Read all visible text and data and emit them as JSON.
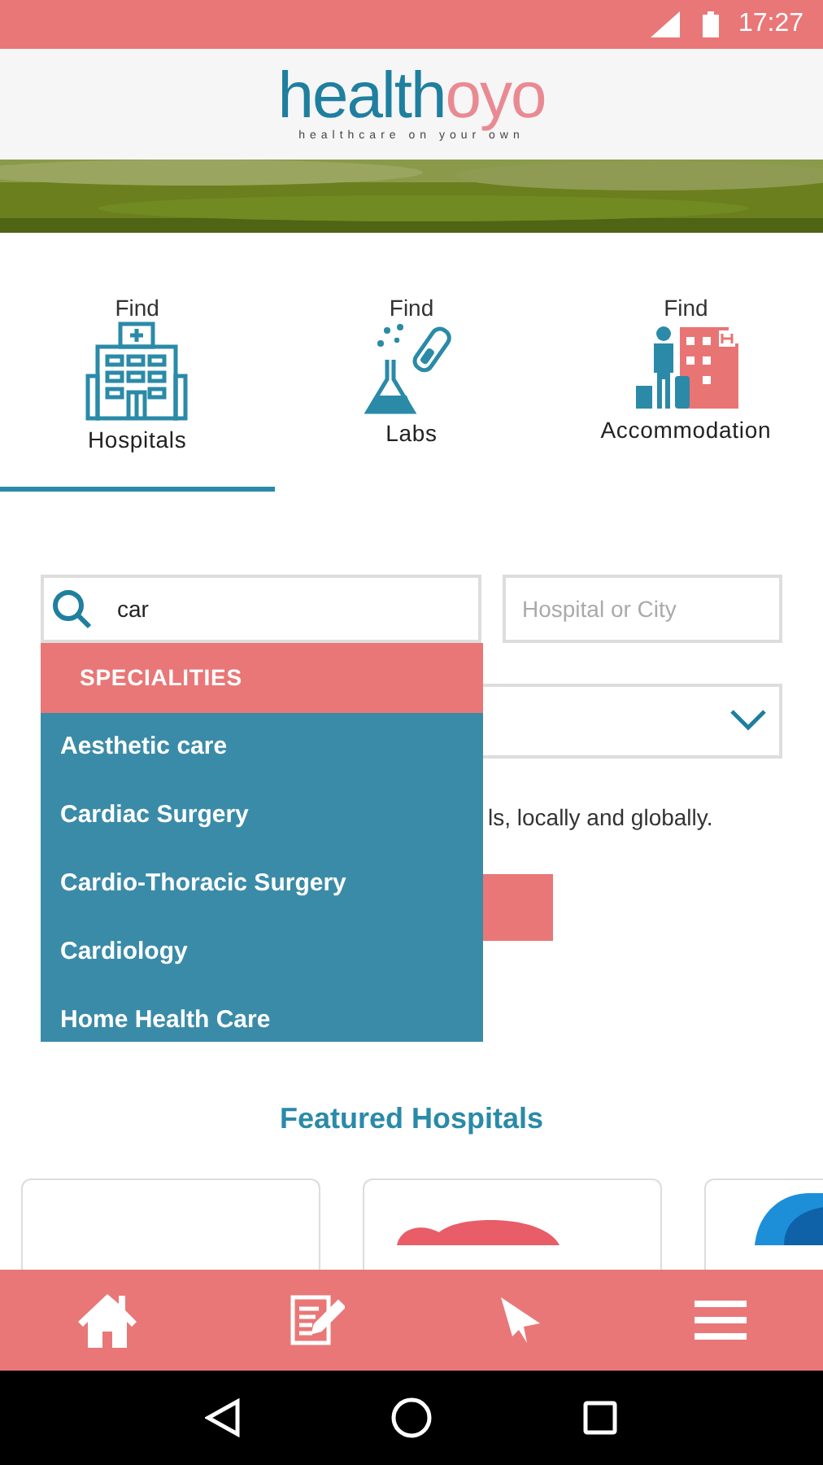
{
  "status_bar": {
    "time": "17:27"
  },
  "logo": {
    "word_start": "health",
    "word_end": "oyo",
    "tagline": "healthcare on your own"
  },
  "tabs": [
    {
      "prefix": "Find",
      "label": "Hospitals",
      "kind": "hospital",
      "selected": true
    },
    {
      "prefix": "Find",
      "label": "Labs",
      "kind": "lab",
      "selected": false
    },
    {
      "prefix": "Find",
      "label": "Accommodation",
      "kind": "hotel",
      "selected": false
    }
  ],
  "search": {
    "value": "car",
    "location_placeholder": "Hospital or City"
  },
  "dropdown": {
    "header": "SPECIALITIES",
    "items": [
      "Aesthetic care",
      "Cardiac Surgery",
      "Cardio-Thoracic Surgery",
      "Cardiology",
      "Home Health Care"
    ]
  },
  "tagline_visible": "ls, locally and globally.",
  "featured": {
    "title": "Featured Hospitals",
    "cards": [
      {
        "kind": "blank"
      },
      {
        "kind": "red"
      },
      {
        "kind": "blue"
      }
    ]
  },
  "bottom_nav": [
    {
      "kind": "home"
    },
    {
      "kind": "form"
    },
    {
      "kind": "send"
    },
    {
      "kind": "menu"
    }
  ]
}
